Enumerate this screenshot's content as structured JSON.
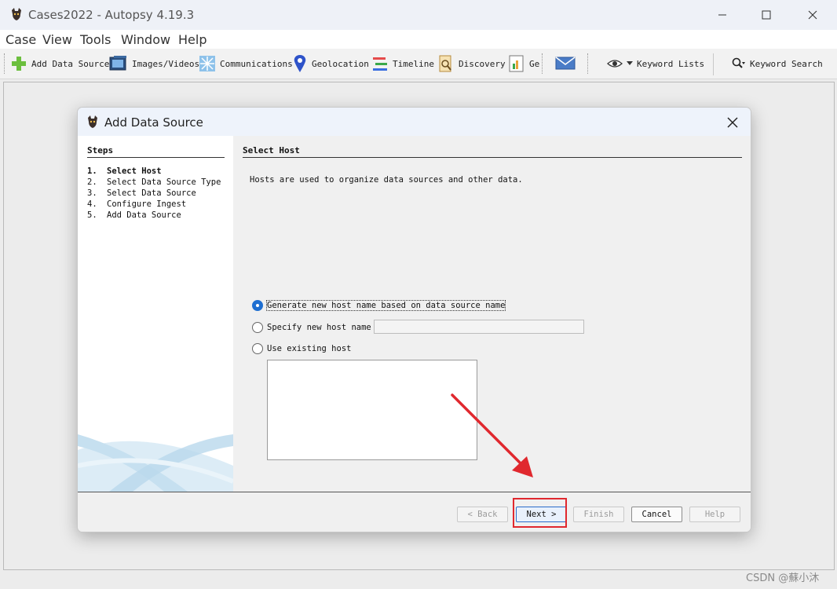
{
  "window": {
    "title": "Cases2022 - Autopsy 4.19.3"
  },
  "menu": {
    "items": [
      "Case",
      "View",
      "Tools",
      "Window",
      "Help"
    ]
  },
  "toolbar": {
    "add_data_source": "Add Data Source",
    "images_videos": "Images/Videos",
    "communications": "Communications",
    "geolocation": "Geolocation",
    "timeline": "Timeline",
    "discovery": "Discovery",
    "generate_report": "Ge",
    "keyword_lists": "Keyword Lists",
    "keyword_search": "Keyword Search"
  },
  "dialog": {
    "title": "Add Data Source",
    "steps_heading": "Steps",
    "steps": [
      {
        "num": "1.",
        "label": "Select Host",
        "active": true
      },
      {
        "num": "2.",
        "label": "Select Data Source Type",
        "active": false
      },
      {
        "num": "3.",
        "label": "Select Data Source",
        "active": false
      },
      {
        "num": "4.",
        "label": "Configure Ingest",
        "active": false
      },
      {
        "num": "5.",
        "label": "Add Data Source",
        "active": false
      }
    ],
    "section_title": "Select Host",
    "description": "Hosts are used to organize data sources and other data.",
    "options": {
      "generate": "Generate new host name based on data source name",
      "specify": "Specify new host name",
      "existing": "Use existing host"
    },
    "selected_option": "generate",
    "host_name_value": "",
    "buttons": {
      "back": "< Back",
      "next": "Next >",
      "finish": "Finish",
      "cancel": "Cancel",
      "help": "Help"
    }
  },
  "watermark_text": "CSDN @蘇小沐",
  "colors": {
    "accent": "#1f6fd1",
    "highlight": "#e0282e"
  }
}
